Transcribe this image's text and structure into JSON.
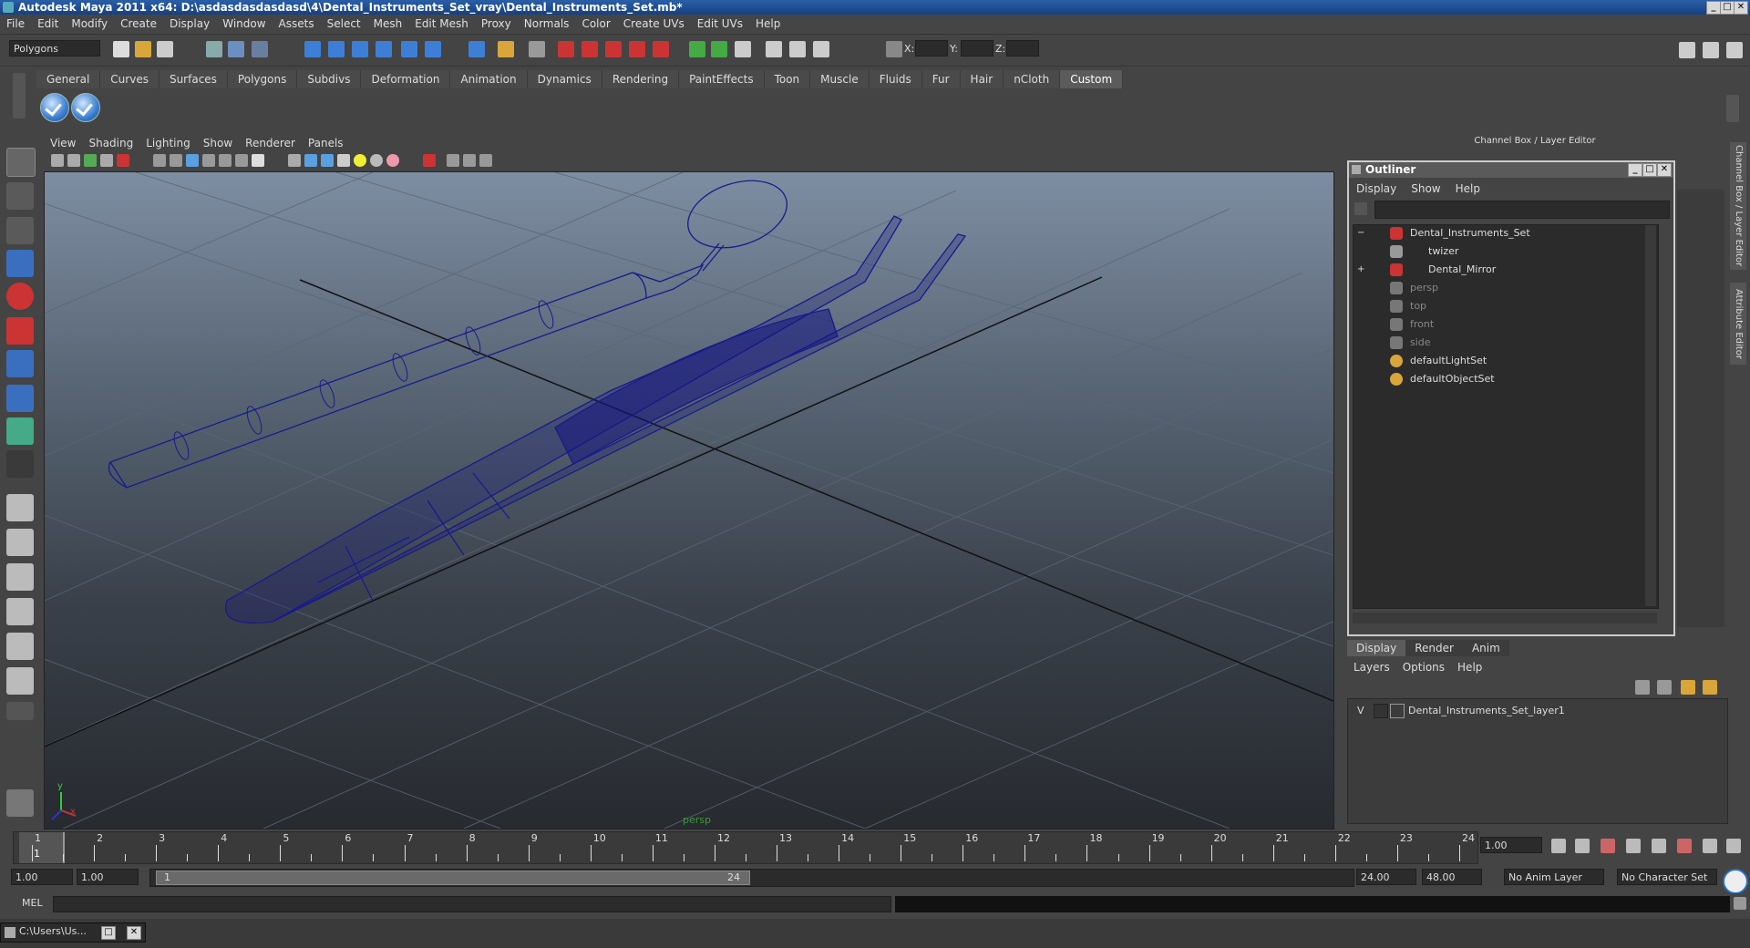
{
  "window": {
    "title": "Autodesk Maya 2011 x64: D:\\asdasdasdasdasd\\4\\Dental_Instruments_Set_vray\\Dental_Instruments_Set.mb*",
    "min": "_",
    "max": "□",
    "close": "✕"
  },
  "menubar": [
    "File",
    "Edit",
    "Modify",
    "Create",
    "Display",
    "Window",
    "Assets",
    "Select",
    "Mesh",
    "Edit Mesh",
    "Proxy",
    "Normals",
    "Color",
    "Create UVs",
    "Edit UVs",
    "Help"
  ],
  "status": {
    "mode_menu": "Polygons",
    "x_label": "X:",
    "y_label": "Y:",
    "z_label": "Z:"
  },
  "shelf": {
    "tabs": [
      "General",
      "Curves",
      "Surfaces",
      "Polygons",
      "Subdivs",
      "Deformation",
      "Animation",
      "Dynamics",
      "Rendering",
      "PaintEffects",
      "Toon",
      "Muscle",
      "Fluids",
      "Fur",
      "Hair",
      "nCloth",
      "Custom"
    ],
    "active_tab": "Custom"
  },
  "viewport": {
    "menu": [
      "View",
      "Shading",
      "Lighting",
      "Show",
      "Renderer",
      "Panels"
    ],
    "camera_label": "persp",
    "axis_y": "y",
    "axis_x": "x",
    "wire_color": "#1a1a8c"
  },
  "channel_box": {
    "header": "Channel Box / Layer Editor"
  },
  "outliner": {
    "title": "Outliner",
    "menu": [
      "Display",
      "Show",
      "Help"
    ],
    "items": [
      {
        "label": "Dental_Instruments_Set",
        "expander": "−"
      },
      {
        "label": "twizer",
        "expander": ""
      },
      {
        "label": "Dental_Mirror",
        "expander": "+"
      },
      {
        "label": "persp",
        "expander": ""
      },
      {
        "label": "top",
        "expander": ""
      },
      {
        "label": "front",
        "expander": ""
      },
      {
        "label": "side",
        "expander": ""
      },
      {
        "label": "defaultLightSet",
        "expander": ""
      },
      {
        "label": "defaultObjectSet",
        "expander": ""
      }
    ]
  },
  "layer_editor": {
    "tabs": [
      "Display",
      "Render",
      "Anim"
    ],
    "active_tab": "Display",
    "menu": [
      "Layers",
      "Options",
      "Help"
    ],
    "layer_visible": "V",
    "layer_name": "Dental_Instruments_Set_layer1"
  },
  "side_tabs": [
    "Channel Box / Layer Editor",
    "Attribute Editor"
  ],
  "timeline": {
    "ticks": [
      "1",
      "2",
      "3",
      "4",
      "5",
      "6",
      "7",
      "8",
      "9",
      "10",
      "11",
      "12",
      "13",
      "14",
      "15",
      "16",
      "17",
      "18",
      "19",
      "20",
      "21",
      "22",
      "23",
      "24"
    ],
    "current_frame": "1.00",
    "current_marker": "1"
  },
  "range": {
    "start": "1.00",
    "playback_start": "1.00",
    "slider_start": "1",
    "slider_end": "24",
    "playback_end": "24.00",
    "end": "48.00",
    "anim_layer": "No Anim Layer",
    "character_set": "No Character Set"
  },
  "command": {
    "label": "MEL"
  },
  "taskbar": {
    "label": "C:\\Users\\Us..."
  }
}
